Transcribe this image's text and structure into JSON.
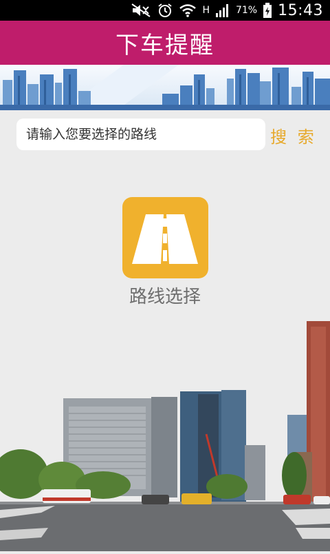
{
  "status_bar": {
    "battery": "71%",
    "time": "15:43",
    "network_type": "H",
    "icons": [
      "mute-icon",
      "alarm-icon",
      "wifi-icon",
      "signal-icon",
      "battery-charging-icon"
    ]
  },
  "header": {
    "title": "下车提醒",
    "color": "#bf1d6b"
  },
  "search": {
    "placeholder": "请输入您要选择的路线",
    "button_label": "搜 索",
    "button_color": "#e7a92b"
  },
  "route_entry": {
    "icon": "road-icon",
    "label": "路线选择",
    "icon_color": "#f0b12d"
  }
}
